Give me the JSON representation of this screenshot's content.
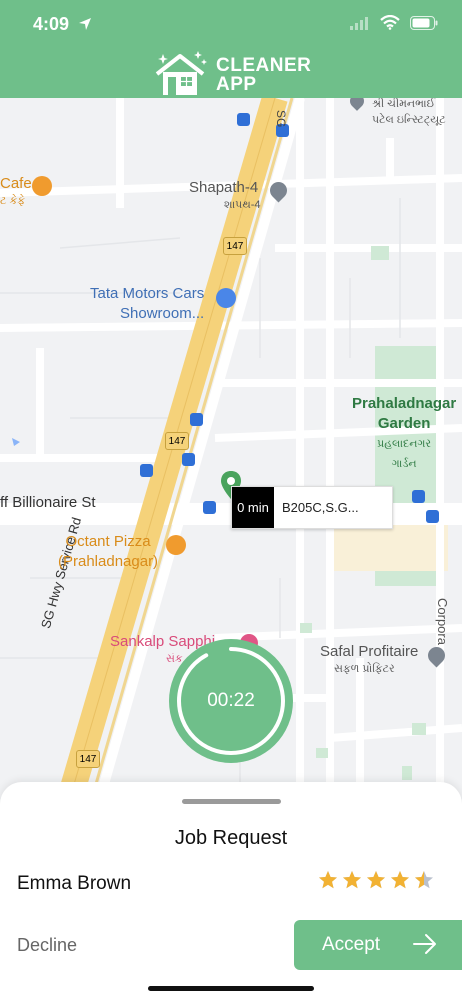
{
  "status_bar": {
    "time": "4:09"
  },
  "header": {
    "app_name_line1": "CLEANER",
    "app_name_line2": "APP"
  },
  "map": {
    "road_labels": {
      "service_rd": "SG Hwy Service Rd",
      "billionaire": "ff Billionaire St",
      "sg_top": "SG"
    },
    "route_shields": [
      "147",
      "147",
      "147"
    ],
    "pois": {
      "cafe": {
        "line1": "Cafe",
        "line2": "ટ કેફે"
      },
      "temple_top": {
        "line1": "શ્રી ચીમનભાઈ",
        "line2": "પટેલ ઇન્સ્ટિટ્યૂટ"
      },
      "shapath": {
        "line1": "Shapath-4",
        "line2": "શાપથ-4"
      },
      "tata": {
        "line1": "Tata Motors Cars",
        "line2": "Showroom..."
      },
      "garden": {
        "line1": "Prahaladnagar",
        "line2": "Garden",
        "line3": "પ્રહલાદનગર",
        "line4": "ગાર્ડન"
      },
      "octant": {
        "line1": "Octant Pizza",
        "line2": "(Prahladnagar)"
      },
      "sankalp": {
        "line1": "Sankalp Sapphi",
        "line2": "સંક"
      },
      "safal": {
        "line1": "Safal Profitaire",
        "line2": "સફળ પ્રોફિટર"
      },
      "corporate": {
        "line1": "Corpora"
      }
    },
    "pin_eta": "0 min",
    "pin_address": "B205C,S.G...",
    "colors": {
      "highway": "#f5d27a",
      "garden": "#cfe9d5",
      "road": "#ffffff"
    }
  },
  "timer": {
    "value": "00:22",
    "progress": 0.92
  },
  "job_request": {
    "title": "Job Request",
    "customer_name": "Emma Brown",
    "rating": 4.5,
    "decline_label": "Decline",
    "accept_label": "Accept"
  },
  "colors": {
    "brand": "#6fbf8a",
    "star": "#f2b233"
  }
}
